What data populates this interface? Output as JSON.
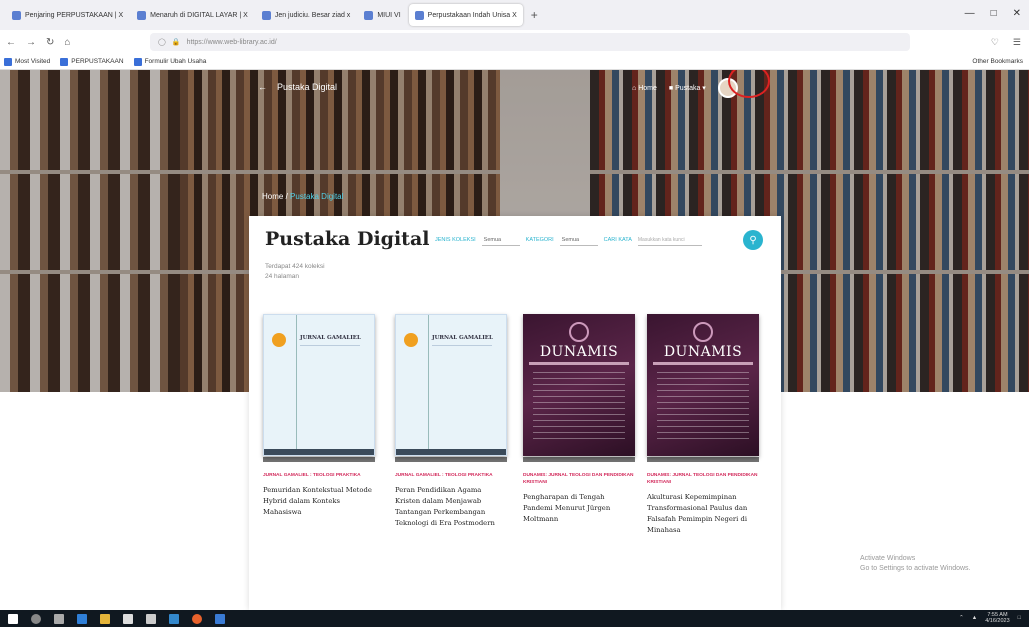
{
  "browser": {
    "tabs": [
      {
        "label": "Penjaring PERPUSTAKAAN | X",
        "active": false
      },
      {
        "label": "Menaruh di DIGITAL LAYAR | X",
        "active": false
      },
      {
        "label": "Jen judiciu. Besar ziad x",
        "active": false
      },
      {
        "label": "MIUI VI",
        "active": false
      },
      {
        "label": "Perpustakaan Indah Unisa X",
        "active": true
      }
    ],
    "new_tab": "+",
    "url": "https://www.web-library.ac.id/",
    "bookmarks": [
      "Most Visited",
      "PERPUSTAKAAN",
      "Formulir Ubah Usaha"
    ],
    "other_bookmarks": "Other Bookmarks"
  },
  "site": {
    "back_label": "Pustaka Digital",
    "nav": [
      "Home",
      "Pustaka"
    ],
    "breadcrumb_home": "Home",
    "breadcrumb_current": "Pustaka Digital"
  },
  "panel": {
    "title": "Pustaka Digital",
    "subtitle_line1": "Terdapat 424 koleksi",
    "subtitle_line2": "24 halaman",
    "filter1_label": "JENIS KOLEKSI",
    "filter1_value": "Semua",
    "filter2_label": "KATEGORI",
    "filter2_value": "Semua",
    "search_label": "CARI KATA",
    "search_placeholder": "Masukkan kata kunci",
    "search_icon": "search-icon"
  },
  "cards": [
    {
      "cover_style": "light",
      "cover_title": "JURNAL GAMALIEL",
      "category": "JURNAL GAMALIEL : TEOLOGI PRAKTIKA",
      "title": "Pemuridan Kontekstual Metode Hybrid dalam Konteks Mahasiswa"
    },
    {
      "cover_style": "light",
      "cover_title": "JURNAL GAMALIEL",
      "category": "JURNAL GAMALIEL : TEOLOGI PRAKTIKA",
      "title": "Peran Pendidikan Agama Kristen dalam Menjawab Tantangan Perkembangan Teknologi di Era Postmodern"
    },
    {
      "cover_style": "dark",
      "cover_title": "DUNAMIS",
      "category": "DUNAMIS: JURNAL TEOLOGI DAN PENDIDIKAN KRISTIANI",
      "title": "Pengharapan di Tengah Pandemi Menurut Jürgen Moltmann"
    },
    {
      "cover_style": "dark",
      "cover_title": "DUNAMIS",
      "category": "DUNAMIS: JURNAL TEOLOGI DAN PENDIDIKAN KRISTIANI",
      "title": "Akulturasi Kepemimpinan Transformasional Paulus dan Falsafah Pemimpin Negeri di Minahasa"
    }
  ],
  "watermark": {
    "line1": "Activate Windows",
    "line2": "Go to Settings to activate Windows."
  },
  "taskbar": {
    "time": "7:55 AM",
    "date": "4/16/2023"
  }
}
